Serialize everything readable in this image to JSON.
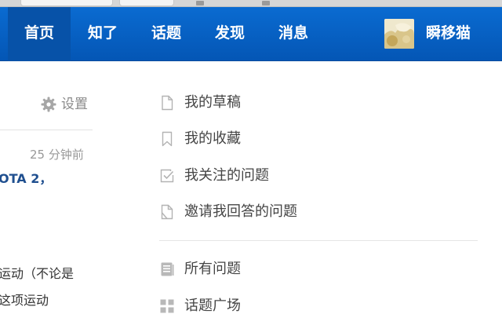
{
  "nav": {
    "items": [
      {
        "label": "首页",
        "active": true
      },
      {
        "label": "知了",
        "active": false
      },
      {
        "label": "话题",
        "active": false
      },
      {
        "label": "发现",
        "active": false
      },
      {
        "label": "消息",
        "active": false
      }
    ],
    "username": "瞬移猫",
    "brand_color": "#0861c8"
  },
  "left": {
    "settings_label": "设置",
    "feed": {
      "time_ago": "25 分钟前",
      "title_fragment": "OTA 2，",
      "text_line1": "运动（不论是",
      "text_line2": "这项运动"
    }
  },
  "menu": {
    "group1": [
      {
        "label": "我的草稿",
        "icon": "document-icon"
      },
      {
        "label": "我的收藏",
        "icon": "bookmark-icon"
      },
      {
        "label": "我关注的问题",
        "icon": "checkbox-icon"
      },
      {
        "label": "邀请我回答的问题",
        "icon": "invite-document-icon"
      }
    ],
    "group2": [
      {
        "label": "所有问题",
        "icon": "list-document-icon"
      },
      {
        "label": "话题广场",
        "icon": "grid-icon"
      }
    ]
  }
}
